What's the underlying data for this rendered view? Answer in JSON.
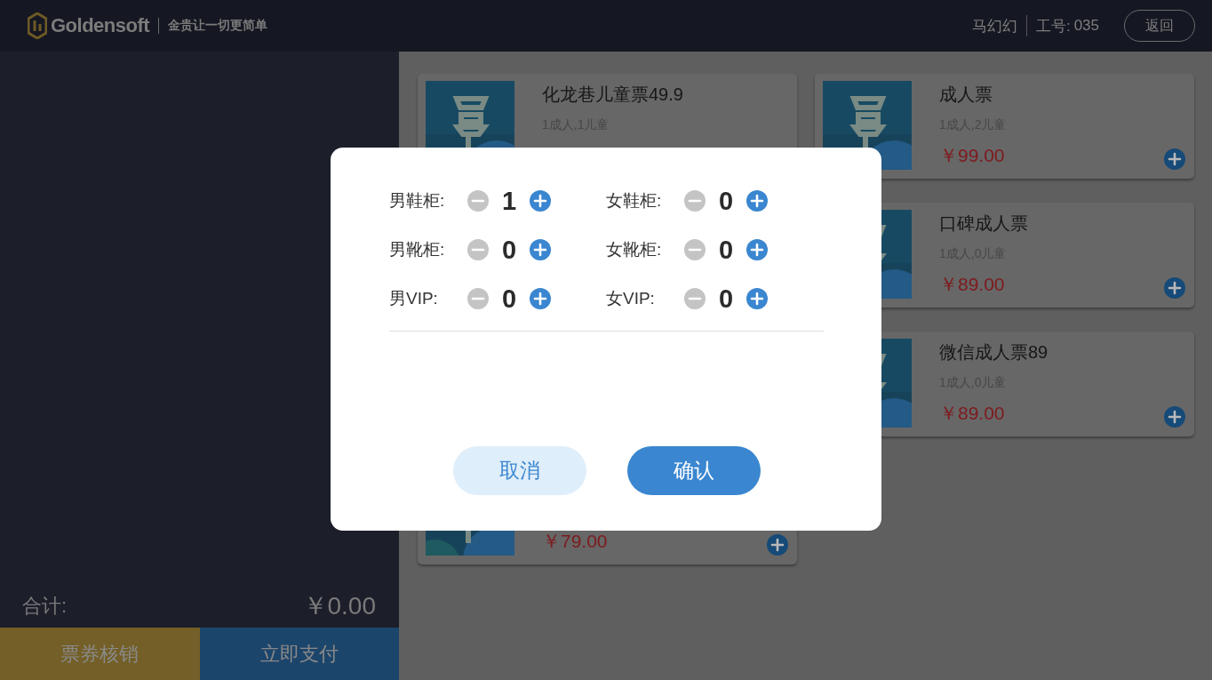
{
  "header": {
    "brand": "Goldensoft",
    "slogan": "金贵让一切更简单",
    "user": "马幻幻",
    "staff_label": "工号:",
    "staff_no": "035",
    "back_button": "返回"
  },
  "cart": {
    "total_label": "合计:",
    "total": "￥0.00",
    "buttons": [
      {
        "label": "票券核销",
        "kind": "voucher"
      },
      {
        "label": "立即支付",
        "kind": "pay"
      }
    ]
  },
  "product_columns": [
    [
      {
        "title": "化龙巷儿童票49.9",
        "subtitle": "1成人,1儿童"
      },
      {
        "price": "￥79.00"
      }
    ],
    [
      {
        "title": "成人票",
        "subtitle": "1成人,2儿童",
        "price": "￥99.00"
      },
      {
        "title": "口碑成人票",
        "subtitle": "1成人,0儿童",
        "price": "￥89.00"
      },
      {
        "title": "微信成人票89",
        "subtitle": "1成人,0儿童",
        "price": "￥89.00"
      }
    ]
  ],
  "dialog": {
    "counters": [
      {
        "label": "男鞋柜:",
        "count": "1"
      },
      {
        "label": "女鞋柜:",
        "count": "0"
      },
      {
        "label": "男靴柜:",
        "count": "0"
      },
      {
        "label": "女靴柜:",
        "count": "0"
      },
      {
        "label": "男VIP:",
        "count": "0"
      },
      {
        "label": "女VIP:",
        "count": "0"
      }
    ],
    "buttons": [
      {
        "label": "取消",
        "kind": "secondary"
      },
      {
        "label": "确认",
        "kind": "primary"
      }
    ]
  }
}
